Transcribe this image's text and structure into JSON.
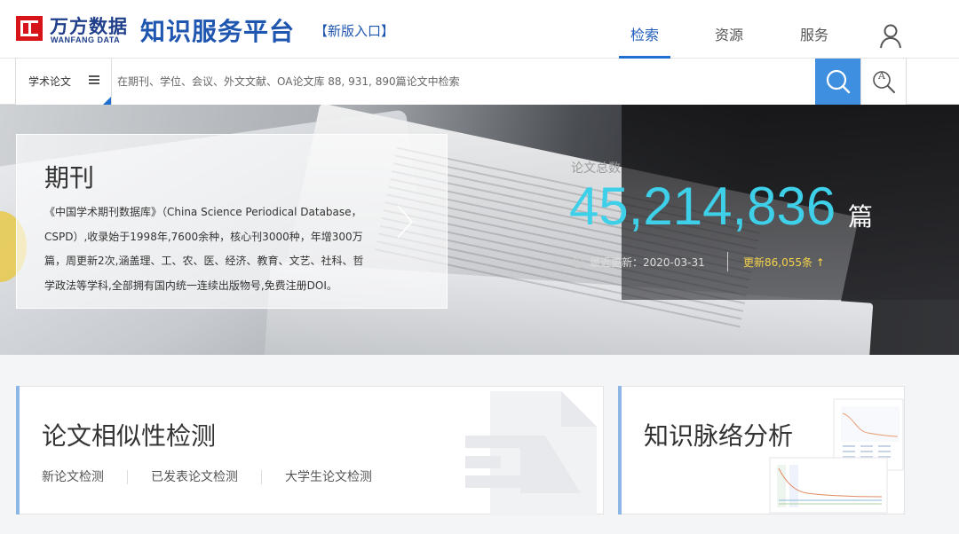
{
  "header": {
    "logo_cn": "万方数据",
    "logo_en": "WANFANG DATA",
    "platform_title": "知识服务平台",
    "new_entry": "【新版入口】",
    "nav": [
      "检索",
      "资源",
      "服务"
    ],
    "active_nav": "检索"
  },
  "search": {
    "type_label": "学术论文",
    "placeholder": "在期刊、学位、会议、外文文献、OA论文库 88, 931, 890篇论文中检索"
  },
  "banner": {
    "journal": {
      "title": "期刊",
      "description": "《中国学术期刊数据库》（China Science Periodical Database，CSPD）,收录始于1998年,7600余种，核心刊3000种，年增300万篇，周更新2次,涵盖理、工、农、医、经济、教育、文艺、社科、哲学政法等学科,全部拥有国内统一连续出版物号,免费注册DOI。"
    },
    "stats": {
      "label": "论文总数",
      "total": "45,214,836",
      "unit": "篇",
      "update_date": "最近更新：2020-03-31",
      "update_count": "更新86,055条 ↑"
    }
  },
  "cards": {
    "similarity": {
      "title": "论文相似性检测",
      "links": [
        "新论文检测",
        "已发表论文检测",
        "大学生论文检测"
      ]
    },
    "knowledge": {
      "title": "知识脉络分析"
    }
  },
  "colors": {
    "brand_blue": "#1f56b0",
    "logo_red": "#d7141a",
    "search_blue": "#3f8fe0",
    "stat_cyan": "#3ed0e8",
    "update_yellow": "#f5d34a"
  },
  "icons": {
    "user": "user-icon",
    "menu": "menu-icon",
    "search": "search-icon",
    "advanced": "advanced-search-icon",
    "chevron": "chevron-right-icon",
    "clock": "clock-icon"
  }
}
